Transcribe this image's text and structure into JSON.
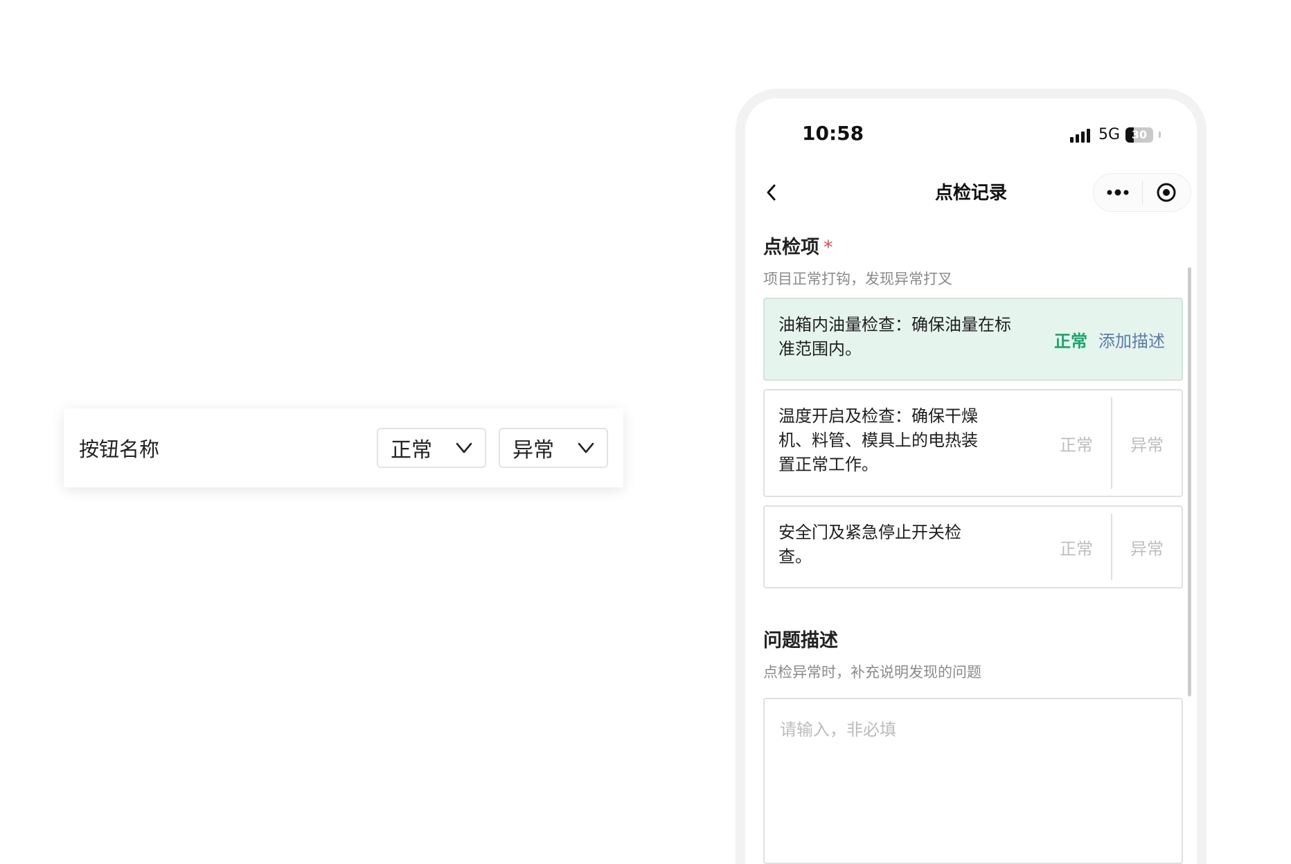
{
  "demo": {
    "label": "按钮名称",
    "select_normal": "正常",
    "select_abnormal": "异常"
  },
  "phone": {
    "status_bar": {
      "time": "10:58",
      "network": "5G",
      "battery": "30",
      "battery_level": 0.3
    },
    "nav": {
      "title": "点检记录",
      "more_icon": "more-dots-icon",
      "target_icon": "record-target-icon"
    },
    "inspection": {
      "title": "点检项",
      "required_mark": "*",
      "hint": "项目正常打钩，发现异常打叉",
      "items": [
        {
          "text": "油箱内油量检查：确保油量在标准范围内。",
          "state": "正常",
          "add_desc": "添加描述"
        },
        {
          "text": "温度开启及检查：确保干燥机、料管、模具上的电热装置正常工作。",
          "normal": "正常",
          "abnormal": "异常"
        },
        {
          "text": "安全门及紧急停止开关检查。",
          "normal": "正常",
          "abnormal": "异常"
        }
      ]
    },
    "problem": {
      "title": "问题描述",
      "hint": "点检异常时，补充说明发现的问题",
      "placeholder": "请输入，非必填"
    }
  },
  "colors": {
    "normal_green": "#1aa56a",
    "checked_bg": "#e6f4ee",
    "link_blue": "#5a7da6",
    "required_red": "#e04a4a"
  }
}
